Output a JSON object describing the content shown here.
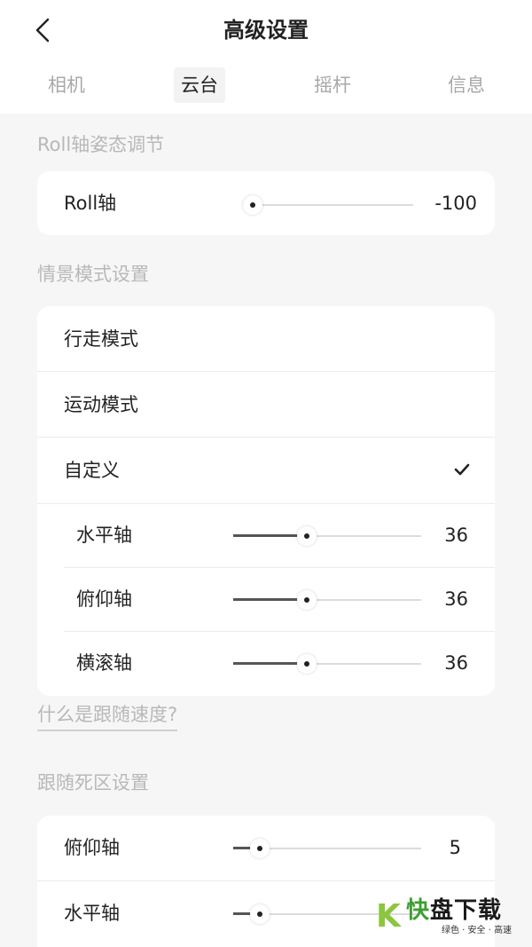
{
  "header": {
    "title": "高级设置"
  },
  "tabs": [
    {
      "label": "相机",
      "active": false
    },
    {
      "label": "云台",
      "active": true
    },
    {
      "label": "摇杆",
      "active": false
    },
    {
      "label": "信息",
      "active": false
    }
  ],
  "roll_section": {
    "title": "Roll轴姿态调节",
    "roll": {
      "label": "Roll轴",
      "value": "-100",
      "fraction": 0.0
    }
  },
  "scene_section": {
    "title": "情景模式设置",
    "modes": [
      "行走模式",
      "运动模式",
      "自定义"
    ],
    "selected_mode": "自定义",
    "sliders": [
      {
        "label": "水平轴",
        "value": "36",
        "fraction": 0.38
      },
      {
        "label": "俯仰轴",
        "value": "36",
        "fraction": 0.38
      },
      {
        "label": "横滚轴",
        "value": "36",
        "fraction": 0.38
      }
    ],
    "help": "什么是跟随速度?"
  },
  "deadzone_section": {
    "title": "跟随死区设置",
    "sliders": [
      {
        "label": "俯仰轴",
        "value": "5",
        "fraction": 0.1
      },
      {
        "label": "水平轴",
        "value": "",
        "fraction": 0.1
      }
    ]
  },
  "watermark": {
    "letter": "K",
    "brand_green": "快",
    "brand_dark": "盘下载",
    "tagline": "绿色 · 安全 · 高速"
  },
  "colors": {
    "accent": "#555555",
    "watermark_green": "#8cc63f"
  },
  "icons": {
    "back": "chevron-left-icon",
    "check": "checkmark-icon"
  }
}
